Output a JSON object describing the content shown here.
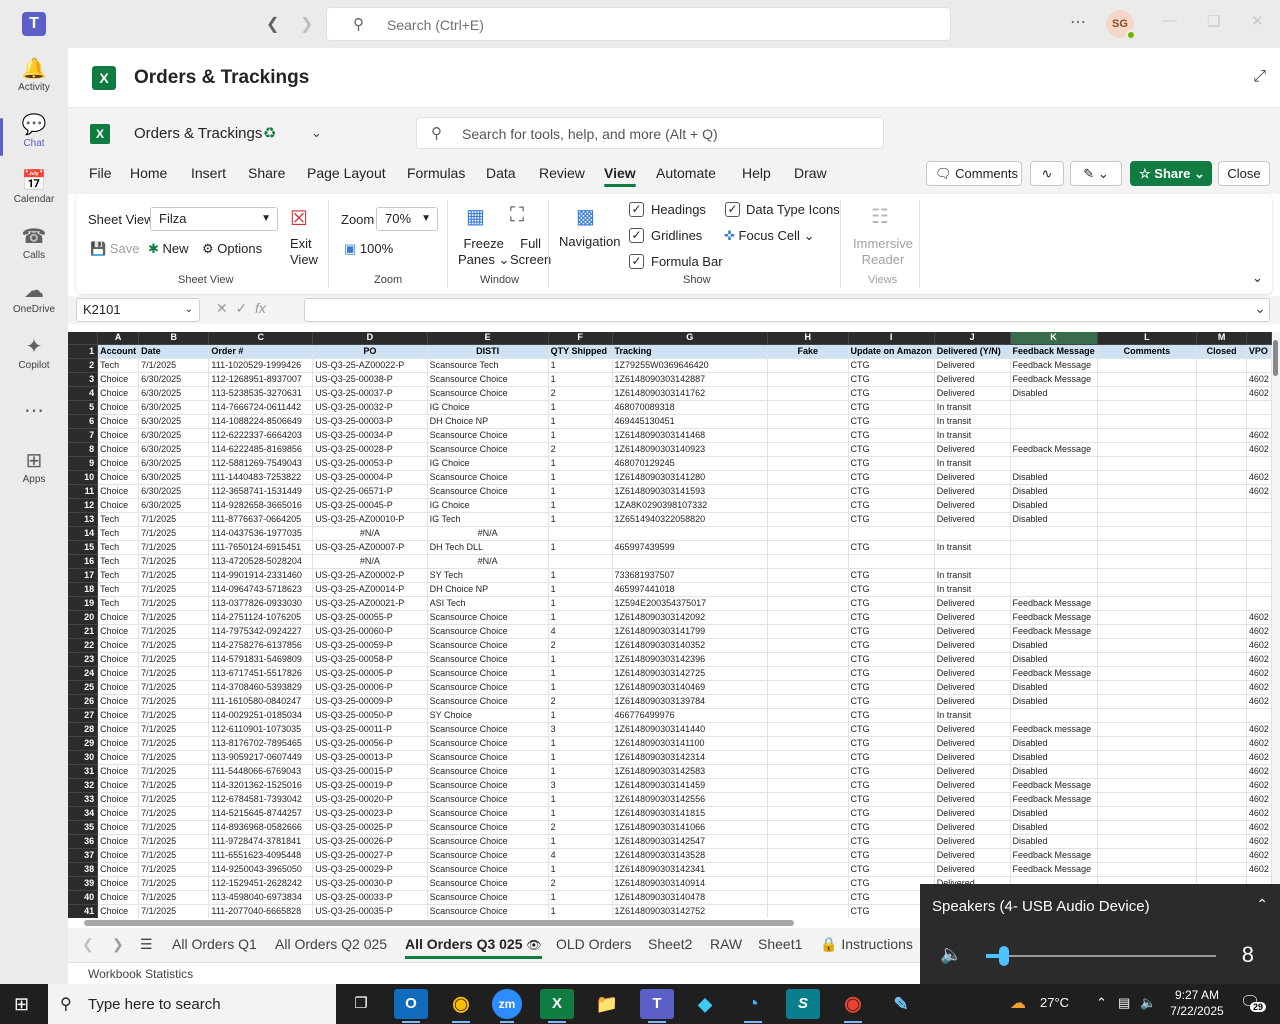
{
  "teams": {
    "search_placeholder": "Search (Ctrl+E)",
    "avatar_initials": "SG",
    "rail": [
      {
        "label": "Activity",
        "icon": "bell-icon"
      },
      {
        "label": "Chat",
        "icon": "chat-icon"
      },
      {
        "label": "Calendar",
        "icon": "calendar-icon"
      },
      {
        "label": "Calls",
        "icon": "phone-icon"
      },
      {
        "label": "OneDrive",
        "icon": "cloud-icon"
      },
      {
        "label": "Copilot",
        "icon": "copilot-icon"
      },
      {
        "label": "",
        "icon": "more-icon"
      },
      {
        "label": "Apps",
        "icon": "apps-icon"
      }
    ]
  },
  "app": {
    "title": "Orders & Trackings"
  },
  "workbook": {
    "name": "Orders & Trackings",
    "search_placeholder": "Search for tools, help, and more (Alt + Q)"
  },
  "menu": {
    "tabs": [
      "File",
      "Home",
      "Insert",
      "Share",
      "Page Layout",
      "Formulas",
      "Data",
      "Review",
      "View",
      "Automate",
      "Help",
      "Draw"
    ],
    "active": "View",
    "comments": "Comments",
    "share": "Share",
    "close": "Close"
  },
  "ribbon": {
    "sheet_view_label": "Sheet View",
    "sheet_view_value": "Filza",
    "save": "Save",
    "new": "New",
    "options": "Options",
    "exit_view": [
      "Exit",
      "View"
    ],
    "group_sheet_view": "Sheet View",
    "zoom_label": "Zoom",
    "zoom_value": "70%",
    "zoom_100": "100%",
    "group_zoom": "Zoom",
    "freeze_panes": [
      "Freeze",
      "Panes"
    ],
    "full_screen": [
      "Full",
      "Screen"
    ],
    "group_window": "Window",
    "navigation": "Navigation",
    "headings": "Headings",
    "gridlines": "Gridlines",
    "formula_bar": "Formula Bar",
    "data_type_icons": "Data Type Icons",
    "focus_cell": "Focus Cell",
    "group_show": "Show",
    "immersive_reader": [
      "Immersive",
      "Reader"
    ],
    "group_views": "Views"
  },
  "formula": {
    "name_box": "K2101",
    "fx": "fx"
  },
  "sheet": {
    "columns": [
      {
        "letter": "A",
        "header": "Account"
      },
      {
        "letter": "B",
        "header": "Date"
      },
      {
        "letter": "C",
        "header": "Order #"
      },
      {
        "letter": "D",
        "header": "PO"
      },
      {
        "letter": "E",
        "header": "DISTI"
      },
      {
        "letter": "F",
        "header": "QTY Shipped"
      },
      {
        "letter": "G",
        "header": "Tracking"
      },
      {
        "letter": "H",
        "header": "Fake"
      },
      {
        "letter": "I",
        "header": "Update on Amazon"
      },
      {
        "letter": "J",
        "header": "Delivered (Y/N)"
      },
      {
        "letter": "K",
        "header": "Feedback Message"
      },
      {
        "letter": "L",
        "header": "Comments"
      },
      {
        "letter": "M",
        "header": "Closed"
      },
      {
        "letter": "",
        "header": "VPO"
      }
    ],
    "rows": [
      [
        "Tech",
        "7/1/2025",
        "111-1020529-1999426",
        "US-Q3-25-AZ00022-P",
        "Scansource Tech",
        "1",
        "1Z79255W0369646420",
        "",
        "CTG",
        "Delivered",
        "Feedback Message",
        "",
        "",
        ""
      ],
      [
        "Choice",
        "6/30/2025",
        "112-1268951-8937007",
        "US-Q3-25-00038-P",
        "Scansource Choice",
        "1",
        "1Z6148090303142887",
        "",
        "CTG",
        "Delivered",
        "Feedback Message",
        "",
        "",
        "4602"
      ],
      [
        "Choice",
        "6/30/2025",
        "113-5238535-3270631",
        "US-Q3-25-00037-P",
        "Scansource Choice",
        "2",
        "1Z6148090303141762",
        "",
        "CTG",
        "Delivered",
        "Disabled",
        "",
        "",
        "4602"
      ],
      [
        "Choice",
        "6/30/2025",
        "114-7666724-0611442",
        "US-Q3-25-00032-P",
        "IG Choice",
        "1",
        "468070089318",
        "",
        "CTG",
        "In transit",
        "",
        "",
        "",
        ""
      ],
      [
        "Choice",
        "6/30/2025",
        "114-1088224-8506649",
        "US-Q3-25-00003-P",
        "DH Choice NP",
        "1",
        "469445130451",
        "",
        "CTG",
        "In transit",
        "",
        "",
        "",
        ""
      ],
      [
        "Choice",
        "6/30/2025",
        "112-6222337-6664203",
        "US-Q3-25-00034-P",
        "Scansource Choice",
        "1",
        "1Z6148090303141468",
        "",
        "CTG",
        "In transit",
        "",
        "",
        "",
        "4602"
      ],
      [
        "Choice",
        "6/30/2025",
        "114-6222485-8169856",
        "US-Q3-25-00028-P",
        "Scansource Choice",
        "2",
        "1Z6148090303140923",
        "",
        "CTG",
        "Delivered",
        "Feedback Message",
        "",
        "",
        "4602"
      ],
      [
        "Choice",
        "6/30/2025",
        "112-5881269-7549043",
        "US-Q3-25-00053-P",
        "IG Choice",
        "1",
        "468070129245",
        "",
        "CTG",
        "In transit",
        "",
        "",
        "",
        ""
      ],
      [
        "Choice",
        "6/30/2025",
        "111-1440483-7253822",
        "US-Q3-25-00004-P",
        "Scansource Choice",
        "1",
        "1Z6148090303141280",
        "",
        "CTG",
        "Delivered",
        "Disabled",
        "",
        "",
        "4602"
      ],
      [
        "Choice",
        "6/30/2025",
        "112-3658741-1531449",
        "US-Q2-25-06571-P",
        "Scansource Choice",
        "1",
        "1Z6148090303141593",
        "",
        "CTG",
        "Delivered",
        "Disabled",
        "",
        "",
        "4602"
      ],
      [
        "Choice",
        "6/30/2025",
        "114-9282658-3665016",
        "US-Q3-25-00045-P",
        "IG Choice",
        "1",
        "1ZA8K0290398107332",
        "",
        "CTG",
        "Delivered",
        "Disabled",
        "",
        "",
        ""
      ],
      [
        "Tech",
        "7/1/2025",
        "111-8776637-0664205",
        "US-Q3-25-AZ00010-P",
        "IG Tech",
        "1",
        "1Z6514940322058820",
        "",
        "CTG",
        "Delivered",
        "Disabled",
        "",
        "",
        ""
      ],
      [
        "Tech",
        "7/1/2025",
        "114-0437536-1977035",
        "#N/A",
        "#N/A",
        "",
        "",
        "",
        "",
        "",
        "",
        "",
        "",
        ""
      ],
      [
        "Tech",
        "7/1/2025",
        "111-7650124-6915451",
        "US-Q3-25-AZ00007-P",
        "DH Tech DLL",
        "1",
        "465997439599",
        "",
        "CTG",
        "In transit",
        "",
        "",
        "",
        ""
      ],
      [
        "Tech",
        "7/1/2025",
        "113-4720528-5028204",
        "#N/A",
        "#N/A",
        "",
        "",
        "",
        "",
        "",
        "",
        "",
        "",
        ""
      ],
      [
        "Tech",
        "7/1/2025",
        "114-9901914-2331460",
        "US-Q3-25-AZ00002-P",
        "SY Tech",
        "1",
        "733681937507",
        "",
        "CTG",
        "In transit",
        "",
        "",
        "",
        ""
      ],
      [
        "Tech",
        "7/1/2025",
        "114-0964743-5718623",
        "US-Q3-25-AZ00014-P",
        "DH Choice NP",
        "1",
        "465997441018",
        "",
        "CTG",
        "In transit",
        "",
        "",
        "",
        ""
      ],
      [
        "Tech",
        "7/1/2025",
        "113-0377826-0933030",
        "US-Q3-25-AZ00021-P",
        "ASI Tech",
        "1",
        "1Z594E200354375017",
        "",
        "CTG",
        "Delivered",
        "Feedback Message",
        "",
        "",
        ""
      ],
      [
        "Choice",
        "7/1/2025",
        "114-2751124-1076205",
        "US-Q3-25-00055-P",
        "Scansource Choice",
        "1",
        "1Z6148090303142092",
        "",
        "CTG",
        "Delivered",
        "Feedback Message",
        "",
        "",
        "4602"
      ],
      [
        "Choice",
        "7/1/2025",
        "114-7975342-0924227",
        "US-Q3-25-00060-P",
        "Scansource Choice",
        "4",
        "1Z6148090303141799",
        "",
        "CTG",
        "Delivered",
        "Feedback Message",
        "",
        "",
        "4602"
      ],
      [
        "Choice",
        "7/1/2025",
        "114-2758276-6137856",
        "US-Q3-25-00059-P",
        "Scansource Choice",
        "2",
        "1Z6148090303140352",
        "",
        "CTG",
        "Delivered",
        "Disabled",
        "",
        "",
        "4602"
      ],
      [
        "Choice",
        "7/1/2025",
        "114-5791831-5469809",
        "US-Q3-25-00058-P",
        "Scansource Choice",
        "1",
        "1Z6148090303142396",
        "",
        "CTG",
        "Delivered",
        "Disabled",
        "",
        "",
        "4602"
      ],
      [
        "Choice",
        "7/1/2025",
        "113-6717451-5517826",
        "US-Q3-25-00005-P",
        "Scansource Choice",
        "1",
        "1Z6148090303142725",
        "",
        "CTG",
        "Delivered",
        "Feedback Message",
        "",
        "",
        "4602"
      ],
      [
        "Choice",
        "7/1/2025",
        "114-3708460-5393829",
        "US-Q3-25-00006-P",
        "Scansource Choice",
        "1",
        "1Z6148090303140469",
        "",
        "CTG",
        "Delivered",
        "Disabled",
        "",
        "",
        "4602"
      ],
      [
        "Choice",
        "7/1/2025",
        "111-1610580-0840247",
        "US-Q3-25-00009-P",
        "Scansource Choice",
        "2",
        "1Z6148090303139784",
        "",
        "CTG",
        "Delivered",
        "Disabled",
        "",
        "",
        "4602"
      ],
      [
        "Choice",
        "7/1/2025",
        "114-0029251-0185034",
        "US-Q3-25-00050-P",
        "SY Choice",
        "1",
        "466776499976",
        "",
        "CTG",
        "In transit",
        "",
        "",
        "",
        ""
      ],
      [
        "Choice",
        "7/1/2025",
        "112-6110901-1073035",
        "US-Q3-25-00011-P",
        "Scansource Choice",
        "3",
        "1Z6148090303141440",
        "",
        "CTG",
        "Delivered",
        "Feedback message",
        "",
        "",
        "4602"
      ],
      [
        "Choice",
        "7/1/2025",
        "113-8176702-7895465",
        "US-Q3-25-00056-P",
        "Scansource Choice",
        "1",
        "1Z6148090303141100",
        "",
        "CTG",
        "Delivered",
        "Disabled",
        "",
        "",
        "4602"
      ],
      [
        "Choice",
        "7/1/2025",
        "113-9059217-0607449",
        "US-Q3-25-00013-P",
        "Scansource Choice",
        "1",
        "1Z6148090303142314",
        "",
        "CTG",
        "Delivered",
        "Disabled",
        "",
        "",
        "4602"
      ],
      [
        "Choice",
        "7/1/2025",
        "111-5448066-6769043",
        "US-Q3-25-00015-P",
        "Scansource Choice",
        "1",
        "1Z6148090303142583",
        "",
        "CTG",
        "Delivered",
        "Disabled",
        "",
        "",
        "4602"
      ],
      [
        "Choice",
        "7/1/2025",
        "114-3201362-1525016",
        "US-Q3-25-00019-P",
        "Scansource Choice",
        "3",
        "1Z6148090303141459",
        "",
        "CTG",
        "Delivered",
        "Feedback Message",
        "",
        "",
        "4602"
      ],
      [
        "Choice",
        "7/1/2025",
        "112-6784581-7393042",
        "US-Q3-25-00020-P",
        "Scansource Choice",
        "1",
        "1Z6148090303142556",
        "",
        "CTG",
        "Delivered",
        "Feedback Message",
        "",
        "",
        "4602"
      ],
      [
        "Choice",
        "7/1/2025",
        "114-5215645-8744257",
        "US-Q3-25-00023-P",
        "Scansource Choice",
        "1",
        "1Z6148090303141815",
        "",
        "CTG",
        "Delivered",
        "Disabled",
        "",
        "",
        "4602"
      ],
      [
        "Choice",
        "7/1/2025",
        "114-8936968-0582666",
        "US-Q3-25-00025-P",
        "Scansource Choice",
        "2",
        "1Z6148090303141066",
        "",
        "CTG",
        "Delivered",
        "Disabled",
        "",
        "",
        "4602"
      ],
      [
        "Choice",
        "7/1/2025",
        "111-9728474-3781841",
        "US-Q3-25-00026-P",
        "Scansource Choice",
        "1",
        "1Z6148090303142547",
        "",
        "CTG",
        "Delivered",
        "Disabled",
        "",
        "",
        "4602"
      ],
      [
        "Choice",
        "7/1/2025",
        "111-6551623-4095448",
        "US-Q3-25-00027-P",
        "Scansource Choice",
        "4",
        "1Z6148090303143528",
        "",
        "CTG",
        "Delivered",
        "Feedback Message",
        "",
        "",
        "4602"
      ],
      [
        "Choice",
        "7/1/2025",
        "114-9250043-3965050",
        "US-Q3-25-00029-P",
        "Scansource Choice",
        "1",
        "1Z6148090303142341",
        "",
        "CTG",
        "Delivered",
        "Feedback Message",
        "",
        "",
        "4602"
      ],
      [
        "Choice",
        "7/1/2025",
        "112-1529451-2628242",
        "US-Q3-25-00030-P",
        "Scansource Choice",
        "2",
        "1Z6148090303140914",
        "",
        "CTG",
        "Delivered",
        "",
        "",
        "",
        ""
      ],
      [
        "Choice",
        "7/1/2025",
        "113-4598040-6973834",
        "US-Q3-25-00033-P",
        "Scansource Choice",
        "1",
        "1Z6148090303140478",
        "",
        "CTG",
        "",
        "",
        "",
        "",
        ""
      ],
      [
        "Choice",
        "7/1/2025",
        "111-2077040-6665828",
        "US-Q3-25-00035-P",
        "Scansource Choice",
        "1",
        "1Z6148090303142752",
        "",
        "CTG",
        "",
        "",
        "",
        "",
        ""
      ]
    ]
  },
  "sheet_tabs": {
    "tabs": [
      "All Orders Q1",
      "All Orders Q2 025",
      "All Orders Q3 025",
      "OLD Orders",
      "Sheet2",
      "RAW",
      "Sheet1",
      "Instructions"
    ],
    "active": "All Orders Q3 025"
  },
  "status": {
    "workbook_statistics": "Workbook Statistics"
  },
  "volume": {
    "device": "Speakers (4- USB Audio Device)",
    "level": 8
  },
  "taskbar": {
    "search_placeholder": "Type here to search",
    "temperature": "27°C",
    "time": "9:27 AM",
    "date": "7/22/2025",
    "notifications": "29"
  }
}
